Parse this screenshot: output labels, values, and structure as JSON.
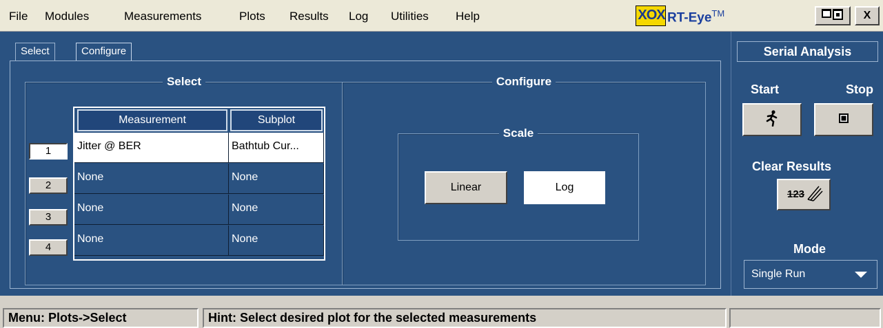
{
  "menu": {
    "items": [
      "File",
      "Modules",
      "Measurements",
      "Plots",
      "Results",
      "Log",
      "Utilities",
      "Help"
    ]
  },
  "app": {
    "logo_text": "XOX",
    "title": "RT-Eye",
    "title_mark": "TM",
    "minimize_icon": "window-minimize-icon",
    "close_label": "X"
  },
  "tabs": [
    "Select",
    "Configure"
  ],
  "select_group": {
    "title": "Select",
    "columns": [
      "Measurement",
      "Subplot"
    ],
    "rows": [
      {
        "num": "1",
        "measurement": "Jitter @ BER",
        "subplot": "Bathtub Cur..."
      },
      {
        "num": "2",
        "measurement": "None",
        "subplot": "None"
      },
      {
        "num": "3",
        "measurement": "None",
        "subplot": "None"
      },
      {
        "num": "4",
        "measurement": "None",
        "subplot": "None"
      }
    ]
  },
  "configure_group": {
    "title": "Configure",
    "scale": {
      "title": "Scale",
      "linear_label": "Linear",
      "log_label": "Log",
      "selected": "Log"
    }
  },
  "right_panel": {
    "header": "Serial Analysis",
    "start_label": "Start",
    "stop_label": "Stop",
    "start_icon": "running-man-icon",
    "stop_icon": "stop-square-icon",
    "clear_label": "Clear Results",
    "clear_icon": "clear-123-icon",
    "clear_icon_text": "123",
    "mode_label": "Mode",
    "mode_value": "Single Run"
  },
  "status": {
    "menu_text": "Menu: Plots->Select",
    "hint_text": "Hint: Select desired plot for the selected measurements"
  },
  "colors": {
    "panel_blue": "#2a5281",
    "logo_yellow": "#f5d800",
    "title_blue": "#1b3f9e"
  }
}
